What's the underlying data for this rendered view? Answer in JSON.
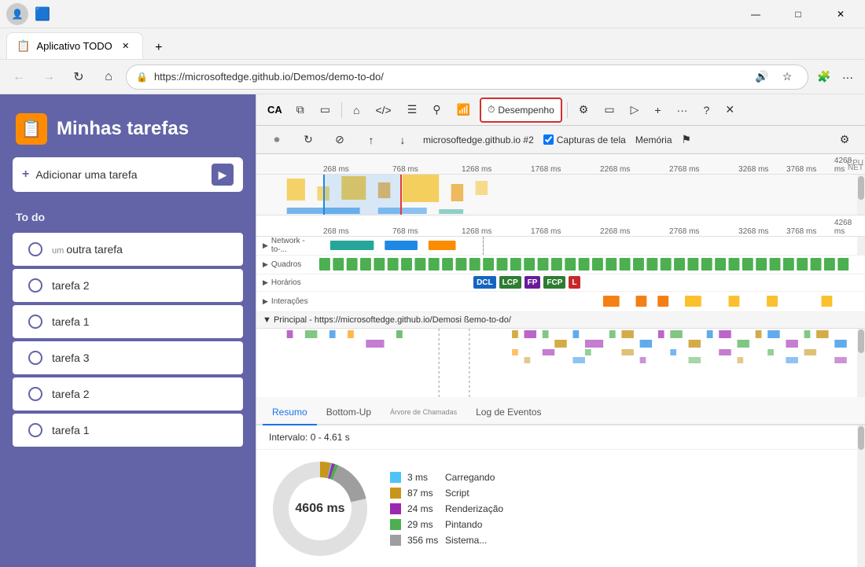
{
  "browser": {
    "title_bar": {
      "minimize": "—",
      "maximize": "□",
      "close": "✕"
    },
    "tab": {
      "label": "Aplicativo TODO",
      "close": "✕"
    },
    "new_tab": "+",
    "address": "https://microsoftedge.github.io/Demos/demo-to-do/",
    "nav": {
      "back": "←",
      "forward": "→",
      "refresh": "↻",
      "home": "⌂"
    }
  },
  "devtools": {
    "toolbar_buttons": [
      {
        "id": "ca",
        "label": "CA",
        "active": false
      },
      {
        "id": "copy",
        "label": "⧉",
        "active": false
      },
      {
        "id": "inspect",
        "label": "▭",
        "active": false
      },
      {
        "id": "home",
        "label": "⌂",
        "active": false
      },
      {
        "id": "code",
        "label": "</>",
        "active": false
      },
      {
        "id": "console",
        "label": "☰",
        "active": false
      },
      {
        "id": "sources",
        "label": "⚲",
        "active": false
      },
      {
        "id": "network",
        "label": "📶",
        "active": false
      },
      {
        "id": "performance",
        "label": "Desempenho",
        "active": true
      },
      {
        "id": "settings",
        "label": "⚙",
        "active": false
      },
      {
        "id": "device",
        "label": "▭",
        "active": false
      },
      {
        "id": "camera",
        "label": "▷",
        "active": false
      },
      {
        "id": "add",
        "label": "+",
        "active": false
      },
      {
        "id": "more",
        "label": "...",
        "active": false
      },
      {
        "id": "help",
        "label": "?",
        "active": false
      },
      {
        "id": "close",
        "label": "✕",
        "active": false
      }
    ],
    "recording_bar": {
      "record_dot": "●",
      "refresh": "↻",
      "cancel": "⊘",
      "upload": "↑",
      "download": "↓",
      "url": "microsoftedge.github.io #2",
      "screenshots_label": "Capturas de tela",
      "memory_label": "Memória",
      "settings_icon": "⚙"
    },
    "timeline": {
      "ruler_labels": [
        "268 ms",
        "768 ms",
        "1268 ms",
        "1768 ms",
        "2268 ms",
        "2768 ms",
        "3268 ms",
        "3768 ms",
        "4268 ms"
      ],
      "second_ruler_labels": [
        "268 ms",
        "768 ms",
        "1268 ms",
        "1768 ms",
        "2268 ms",
        "2768 ms",
        "3268 ms",
        "3768 ms",
        "4268 ms"
      ],
      "cpu_label": "CPU",
      "net_label": "NET",
      "rows": [
        {
          "id": "network",
          "label": "Network - to-...",
          "expand": true
        },
        {
          "id": "frames",
          "label": "Quadros",
          "expand": true
        },
        {
          "id": "timings",
          "label": "Horários",
          "expand": true
        },
        {
          "id": "interactions",
          "label": "Interações",
          "expand": true
        }
      ],
      "timing_badges": [
        {
          "label": "DCL",
          "color": "#1565c0"
        },
        {
          "label": "LCP",
          "color": "#2e7d32"
        },
        {
          "label": "FP",
          "color": "#6a1b9a"
        },
        {
          "label": "FCP",
          "color": "#2e7d32"
        },
        {
          "label": "L",
          "color": "#c62828"
        }
      ],
      "main_thread_label": "▼ Principal - https://microsoftedge.github.io/Demosi ßemo-to-do/"
    },
    "bottom": {
      "tabs": [
        {
          "id": "resumo",
          "label": "Resumo",
          "active": true
        },
        {
          "id": "bottom-up",
          "label": "Bottom-Up",
          "active": false
        },
        {
          "id": "arvore",
          "label": "Árvore de Chamadas",
          "active": false
        },
        {
          "id": "log",
          "label": "Log de Eventos",
          "active": false
        }
      ],
      "interval_label": "Intervalo: 0 - 4.61 s",
      "donut": {
        "center_ms": "4606 ms",
        "total_angle": 360
      },
      "legend": [
        {
          "id": "loading",
          "value": "3 ms",
          "label": "Carregando",
          "color": "#4fc3f7"
        },
        {
          "id": "script",
          "value": "87 ms",
          "label": "Script",
          "color": "#c8961a"
        },
        {
          "id": "rendering",
          "value": "24 ms",
          "label": "Renderização",
          "color": "#9c27b0"
        },
        {
          "id": "painting",
          "value": "29 ms",
          "label": "Pintando",
          "color": "#4caf50"
        },
        {
          "id": "system",
          "value": "356 ms",
          "label": "Sistema...",
          "color": "#9e9e9e"
        }
      ]
    }
  },
  "app": {
    "title": "Minhas tarefas",
    "add_task_placeholder": "Adicionar uma tarefa",
    "list_section_label": "To do",
    "tasks": [
      {
        "id": 1,
        "label": "um outra tarefa",
        "small": "um"
      },
      {
        "id": 2,
        "label": "tarefa 2"
      },
      {
        "id": 3,
        "label": "tarefa 1"
      },
      {
        "id": 4,
        "label": "tarefa 3"
      },
      {
        "id": 5,
        "label": "tarefa 2"
      },
      {
        "id": 6,
        "label": "tarefa 1"
      }
    ]
  },
  "colors": {
    "sidebar_bg": "#6264a7",
    "active_tab_border": "#d32f2f",
    "devtools_active_bg": "#ffffff",
    "address_bg": "#ffffff",
    "ruler_bg": "#f8f8f8",
    "net_bar_teal": "#26a69a",
    "net_bar_blue": "#1e88e5",
    "net_bar_orange": "#fb8c00",
    "frame_green": "#4caf50",
    "timing_dcl": "#1565c0",
    "timing_lcp": "#2e7d32",
    "timing_fp": "#6a1b9a",
    "timing_fcp": "#2e7d32",
    "timing_l": "#c62828"
  }
}
